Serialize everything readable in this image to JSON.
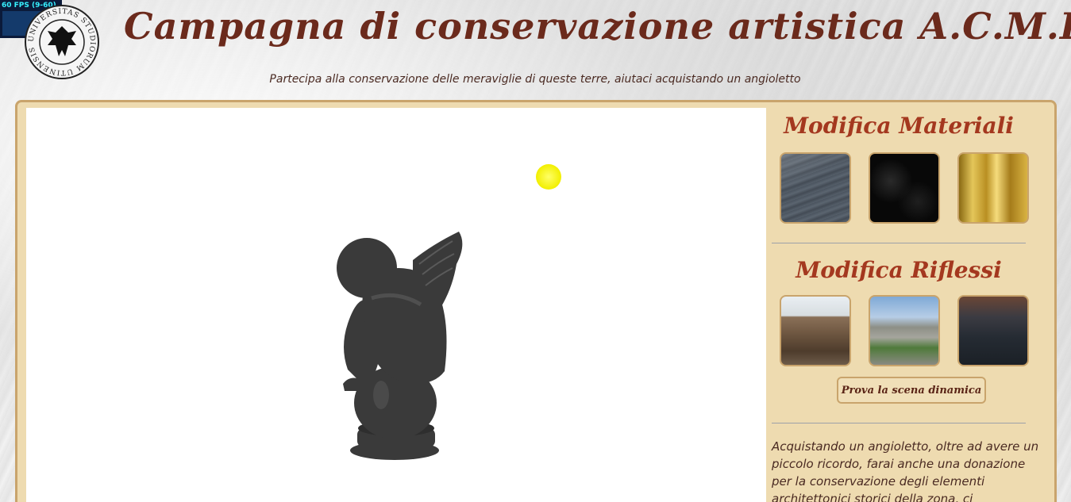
{
  "fps": {
    "label": "60 FPS (9-60)"
  },
  "seal": {
    "ring_text": "UNIVERSITAS STUDIORUM UTINENSIS"
  },
  "header": {
    "title": "Campagna di conservazione artistica A.C.M.E.",
    "subtitle": "Partecipa alla conservazione delle meraviglie di queste terre, aiutaci acquistando un angioletto"
  },
  "viewer": {
    "light_color": "#f2ef00",
    "statue_color": "#3a3a3a"
  },
  "sidebar": {
    "materials_title": "Modifica Materiali",
    "materials": [
      {
        "name": "slate",
        "color": "#4d5560"
      },
      {
        "name": "black-marble",
        "color": "#0d0d0d"
      },
      {
        "name": "gold",
        "color": "#c9a52a"
      }
    ],
    "reflections_title": "Modifica Riflessi",
    "reflections": [
      {
        "name": "colosseum-interior"
      },
      {
        "name": "colosseum-exterior"
      },
      {
        "name": "colosseum-night"
      }
    ],
    "dynamic_button": "Prova la scena dinamica",
    "description": "Acquistando un angioletto, oltre ad avere un piccolo ricordo, farai anche una donazione per la conservazione degli elementi architettonici storici della zona, ci"
  },
  "colors": {
    "accent": "#a4381f",
    "title": "#6b2a1c",
    "panel": "#eedbb0",
    "border": "#c9a46c"
  }
}
